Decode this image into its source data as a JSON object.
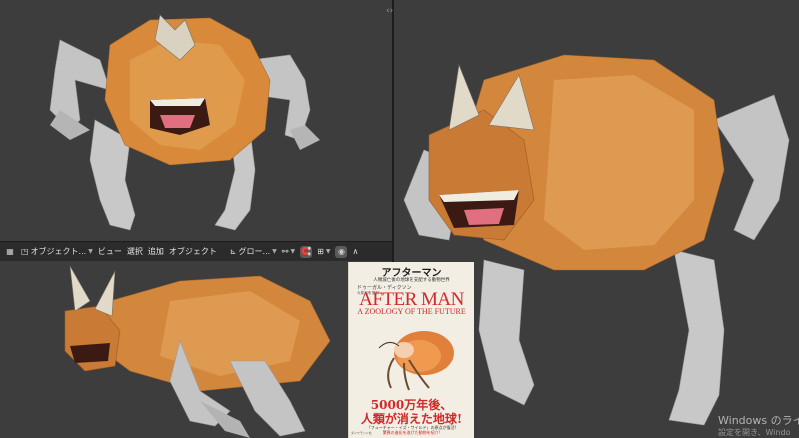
{
  "header": {
    "mode_label": "オブジェクト...",
    "menu": [
      "ビュー",
      "選択",
      "追加",
      "オブジェクト"
    ],
    "transform_label": "グロー..."
  },
  "book": {
    "title_jp": "アフターマン",
    "subtitle_jp": "人類滅亡後の地球を支配する動物世界",
    "author": "ドゥーガル・ディクソン",
    "translator": "今泉吉晴 監訳",
    "title_en": "AFTER MAN",
    "subtitle_en": "A ZOOLOGY OF THE FUTURE",
    "tagline1": "5000万年後、",
    "tagline2": "人類が消えた地球!",
    "note1": "「フューチャー・イズ・ワイルド」の原点が復活!",
    "note2": "驚異の進化を遂げた動物を紹介!",
    "publisher": "ダイヤモンド社"
  },
  "watermark": {
    "line1": "Windows のライ",
    "line2": "設定を開き、Windo"
  },
  "colors": {
    "viewport_bg": "#3d3d3d",
    "header_bg": "#2b2b2b",
    "body_orange": "#d2873c",
    "limb_grey": "#bdbdbd",
    "book_red": "#d1282a"
  }
}
